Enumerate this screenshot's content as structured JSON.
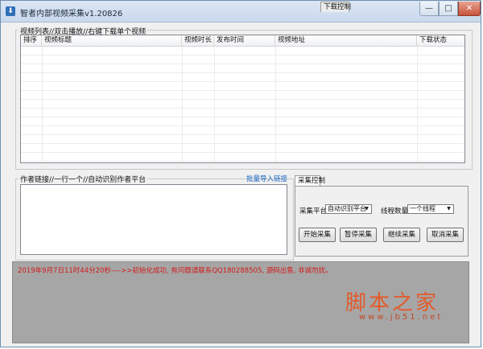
{
  "window": {
    "title": "智者内部视频采集v1.20826",
    "min_symbol": "—",
    "max_symbol": "□",
    "close_symbol": "✕",
    "icon": "download-icon"
  },
  "video_list": {
    "label": "视频列表//双击播放//右键下载单个视频",
    "columns": [
      "排序",
      "视频标题",
      "视频时长",
      "发布时间",
      "视频地址",
      "下载状态"
    ]
  },
  "author_links": {
    "label": "作者链接//一行一个//自动识别作者平台",
    "batch_import": "批量导入链接",
    "value": ""
  },
  "tabs": [
    "采集控制",
    "下载控制"
  ],
  "controls": {
    "platform_label": "采集平台:",
    "platform_value": "自动识别平台",
    "thread_label": "线程数量:",
    "thread_value": "一个线程",
    "buttons": [
      "开始采集",
      "暂停采集",
      "继续采集",
      "取消采集"
    ]
  },
  "status": {
    "log": "2019年9月7日11时44分20秒---->>初始化成功, 有问题请联系QQ180288505, 源码出售, 非诚勿扰。"
  },
  "watermark": {
    "text": "脚本之家",
    "url": "www.jb51.net"
  },
  "colors": {
    "status_text": "#d21b1b",
    "link": "#1565c0",
    "watermark": "#e35a2a"
  }
}
